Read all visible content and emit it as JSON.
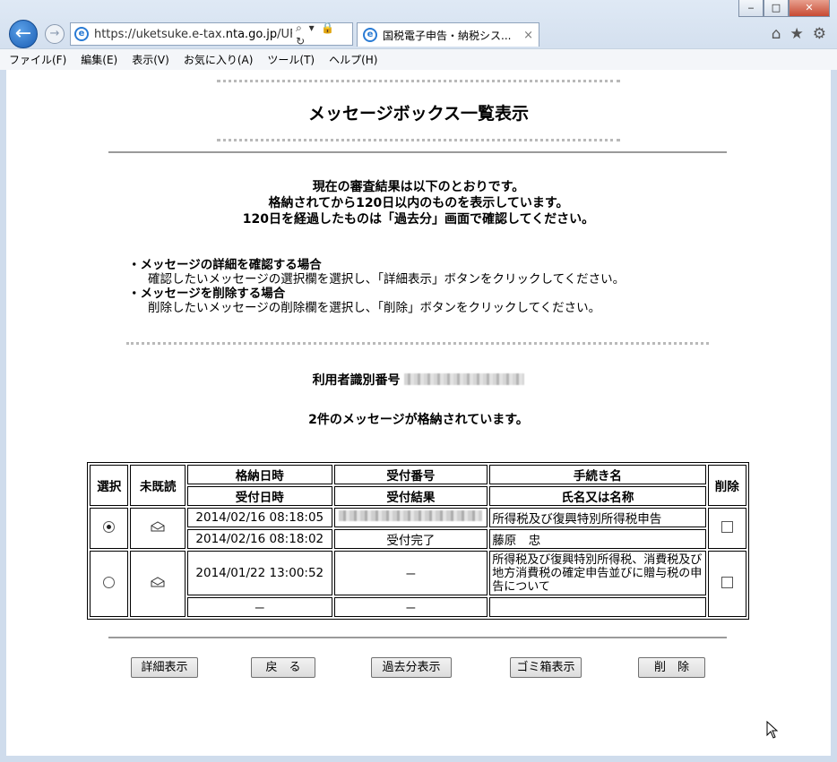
{
  "browser": {
    "url_prefix": "https://",
    "url_host": "uketsuke.e-tax.",
    "url_domain": "nta.go.jp",
    "url_rest": "/UF_/",
    "url_tools": "⌕ ▾ 🔒 ↻",
    "tab_title": "国税電子申告・納税シス...",
    "tab_close": "×",
    "back_glyph": "←",
    "forward_glyph": "→",
    "window_buttons": [
      "‒",
      "□",
      "✕"
    ],
    "toolbar_icons": [
      "⌂",
      "★",
      "⚙"
    ]
  },
  "menu": [
    "ファイル(F)",
    "編集(E)",
    "表示(V)",
    "お気に入り(A)",
    "ツール(T)",
    "ヘルプ(H)"
  ],
  "page": {
    "title": "メッセージボックス一覧表示",
    "notice": [
      "現在の審査結果は以下のとおりです。",
      "格納されてから120日以内のものを表示しています。",
      "120日を経過したものは「過去分」画面で確認してください。"
    ],
    "howto": [
      {
        "heading": "・メッセージの詳細を確認する場合",
        "detail": "確認したいメッセージの選択欄を選択し、「詳細表示」ボタンをクリックしてください。"
      },
      {
        "heading": "・メッセージを削除する場合",
        "detail": "削除したいメッセージの削除欄を選択し、「削除」ボタンをクリックしてください。"
      }
    ],
    "user_id_label": "利用者識別番号",
    "message_count": "2件のメッセージが格納されています。"
  },
  "table": {
    "headers": {
      "select": "選択",
      "unread": "未既読",
      "stored_at": "格納日時",
      "received_at": "受付日時",
      "receipt_no": "受付番号",
      "receipt_result": "受付結果",
      "procedure": "手続き名",
      "name": "氏名又は名称",
      "delete": "削除"
    },
    "rows": [
      {
        "selected": true,
        "stored_at": "2014/02/16 08:18:05",
        "received_at": "2014/02/16 08:18:02",
        "receipt_result": "受付完了",
        "procedure": "所得税及び復興特別所得税申告",
        "name": "藤原　忠"
      },
      {
        "selected": false,
        "stored_at": "2014/01/22 13:00:52",
        "received_at": "－",
        "receipt_no": "－",
        "receipt_result": "－",
        "procedure": "所得税及び復興特別所得税、消費税及び地方消費税の確定申告並びに贈与税の申告について",
        "name": ""
      }
    ]
  },
  "buttons": {
    "detail": "詳細表示",
    "back": "戻　る",
    "past": "過去分表示",
    "trash": "ゴミ箱表示",
    "delete": "削　除"
  }
}
